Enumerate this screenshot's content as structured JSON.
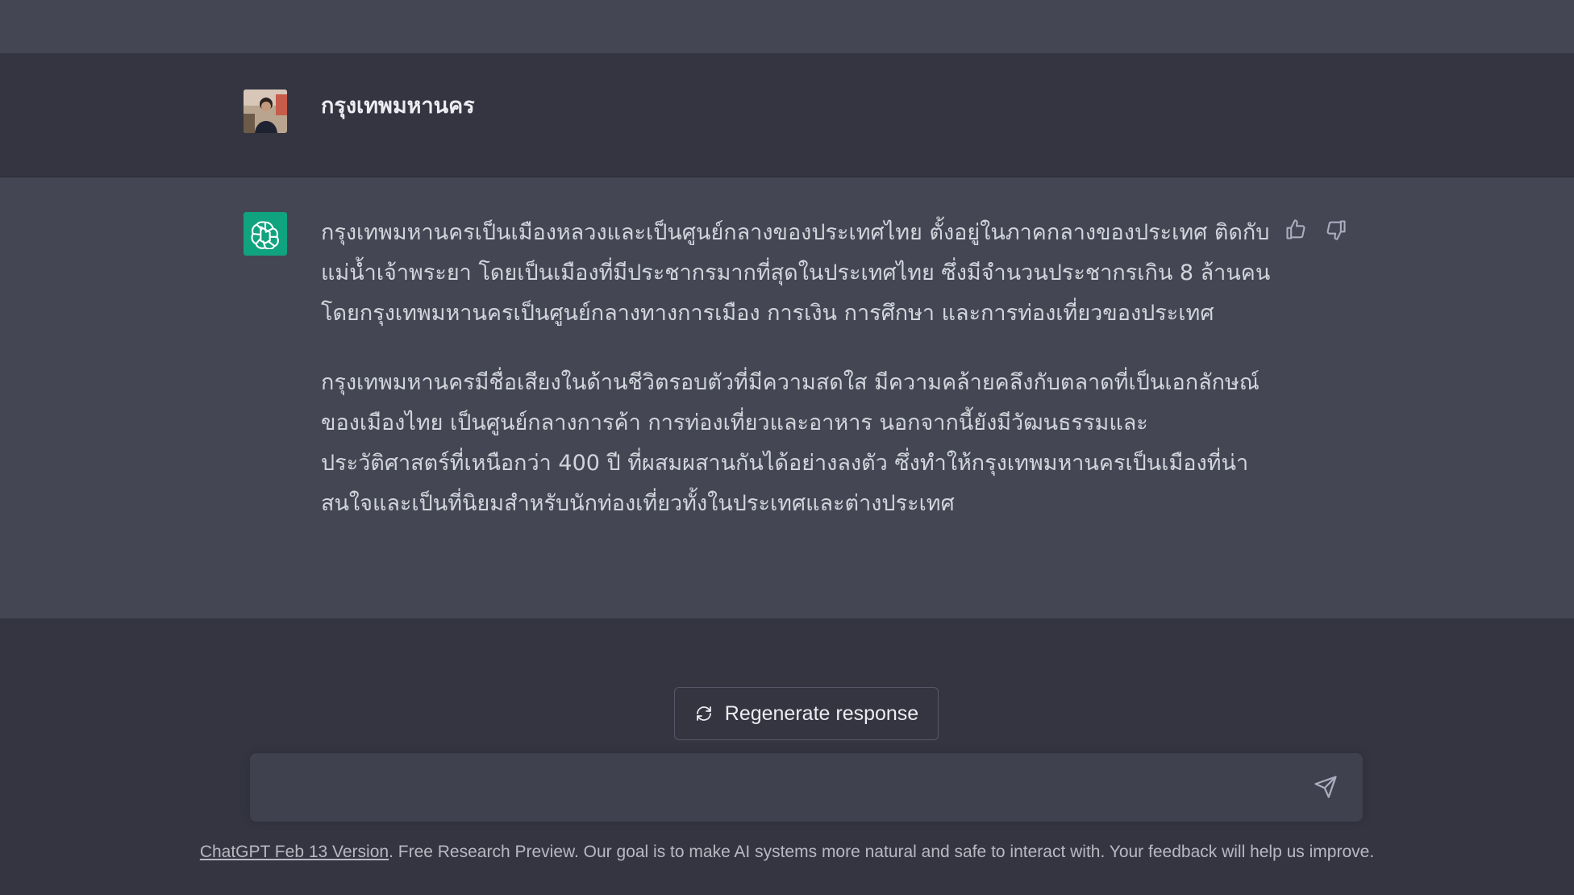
{
  "conversation": {
    "user_message": "กรุงเทพมหานคร",
    "assistant_paragraphs": [
      "กรุงเทพมหานครเป็นเมืองหลวงและเป็นศูนย์กลางของประเทศไทย ตั้งอยู่ในภาคกลางของประเทศ ติดกับแม่น้ำเจ้าพระยา โดยเป็นเมืองที่มีประชากรมากที่สุดในประเทศไทย ซึ่งมีจำนวนประชากรเกิน 8 ล้านคน โดยกรุงเทพมหานครเป็นศูนย์กลางทางการเมือง การเงิน การศึกษา และการท่องเที่ยวของประเทศ",
      "กรุงเทพมหานครมีชื่อเสียงในด้านชีวิตรอบตัวที่มีความสดใส มีความคล้ายคลึงกับตลาดที่เป็นเอกลักษณ์ของเมืองไทย เป็นศูนย์กลางการค้า การท่องเที่ยวและอาหาร นอกจากนี้ยังมีวัฒนธรรมและประวัติศาสตร์ที่เหนือกว่า 400 ปี ที่ผสมผสานกันได้อย่างลงตัว ซึ่งทำให้กรุงเทพมหานครเป็นเมืองที่น่าสนใจและเป็นที่นิยมสำหรับนักท่องเที่ยวทั้งในประเทศและต่างประเทศ"
    ]
  },
  "icons": {
    "avatar": "user-avatar-photo",
    "assistant": "openai-logo-icon",
    "thumbs_up": "thumbs-up-icon",
    "thumbs_down": "thumbs-down-icon",
    "regenerate": "refresh-icon",
    "send": "send-icon"
  },
  "actions": {
    "regenerate_label": "Regenerate response"
  },
  "input": {
    "value": "",
    "placeholder": ""
  },
  "footer": {
    "link_text": "ChatGPT Feb 13 Version",
    "text": ". Free Research Preview. Our goal is to make AI systems more natural and safe to interact with. Your feedback will help us improve."
  },
  "colors": {
    "background": "#343541",
    "assistant_background": "#444654",
    "assistant_logo": "#10a37f",
    "input_background": "#40414f"
  }
}
